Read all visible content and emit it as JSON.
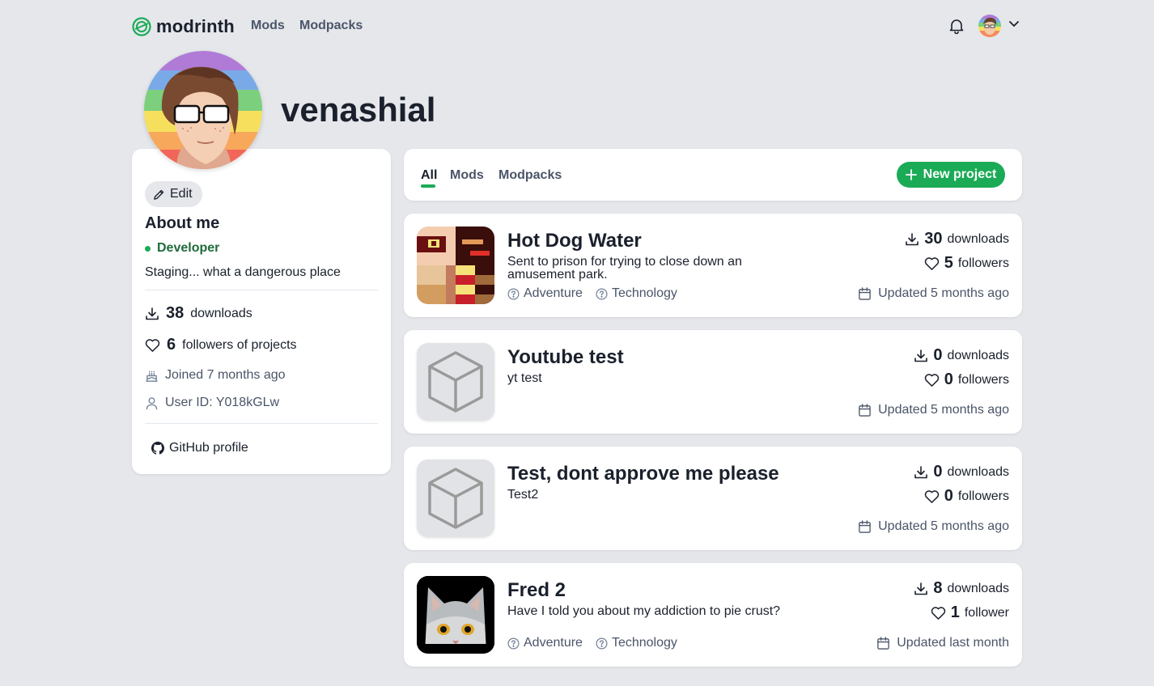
{
  "header": {
    "brand": "modrinth",
    "nav": [
      {
        "label": "Mods"
      },
      {
        "label": "Modpacks"
      }
    ]
  },
  "profile": {
    "username": "venashial",
    "edit_label": "Edit",
    "about_heading": "About me",
    "role": "Developer",
    "bio": "Staging... what a dangerous place",
    "downloads_count": "38",
    "downloads_label": "downloads",
    "followers_count": "6",
    "followers_label": "followers of projects",
    "joined": "Joined 7 months ago",
    "user_id": "User ID: Y018kGLw",
    "github_label": "GitHub profile"
  },
  "tabs": [
    {
      "label": "All"
    },
    {
      "label": "Mods"
    },
    {
      "label": "Modpacks"
    }
  ],
  "active_tab": "All",
  "new_project_label": "New project",
  "projects": [
    {
      "title": "Hot Dog Water",
      "description": "Sent to prison for trying to close down an amusement park.",
      "tags": [
        "Adventure",
        "Technology"
      ],
      "downloads": "30",
      "downloads_label": "downloads",
      "followers": "5",
      "followers_label": "followers",
      "updated": "Updated 5 months ago"
    },
    {
      "title": "Youtube test",
      "description": "yt test",
      "tags": [],
      "downloads": "0",
      "downloads_label": "downloads",
      "followers": "0",
      "followers_label": "followers",
      "updated": "Updated 5 months ago"
    },
    {
      "title": "Test, dont approve me please",
      "description": "Test2",
      "tags": [],
      "downloads": "0",
      "downloads_label": "downloads",
      "followers": "0",
      "followers_label": "followers",
      "updated": "Updated 5 months ago"
    },
    {
      "title": "Fred 2",
      "description": "Have I told you about my addiction to pie crust?",
      "tags": [
        "Adventure",
        "Technology"
      ],
      "downloads": "8",
      "downloads_label": "downloads",
      "followers": "1",
      "followers_label": "follower",
      "updated": "Updated last month"
    }
  ],
  "colors": {
    "brand_green": "#1bab56",
    "background": "#e5e7eb",
    "card": "#ffffff"
  },
  "icons": {
    "logo": "modrinth-logo-icon",
    "notifications": "bell-icon",
    "menu": "chevron-down-icon",
    "edit": "pencil-icon",
    "downloads": "download-icon",
    "followers": "heart-icon",
    "joined": "cake-icon",
    "user_id": "user-icon",
    "github": "github-icon",
    "add": "plus-icon",
    "tag": "help-circle-icon",
    "updated": "calendar-icon",
    "placeholder": "cube-icon"
  }
}
